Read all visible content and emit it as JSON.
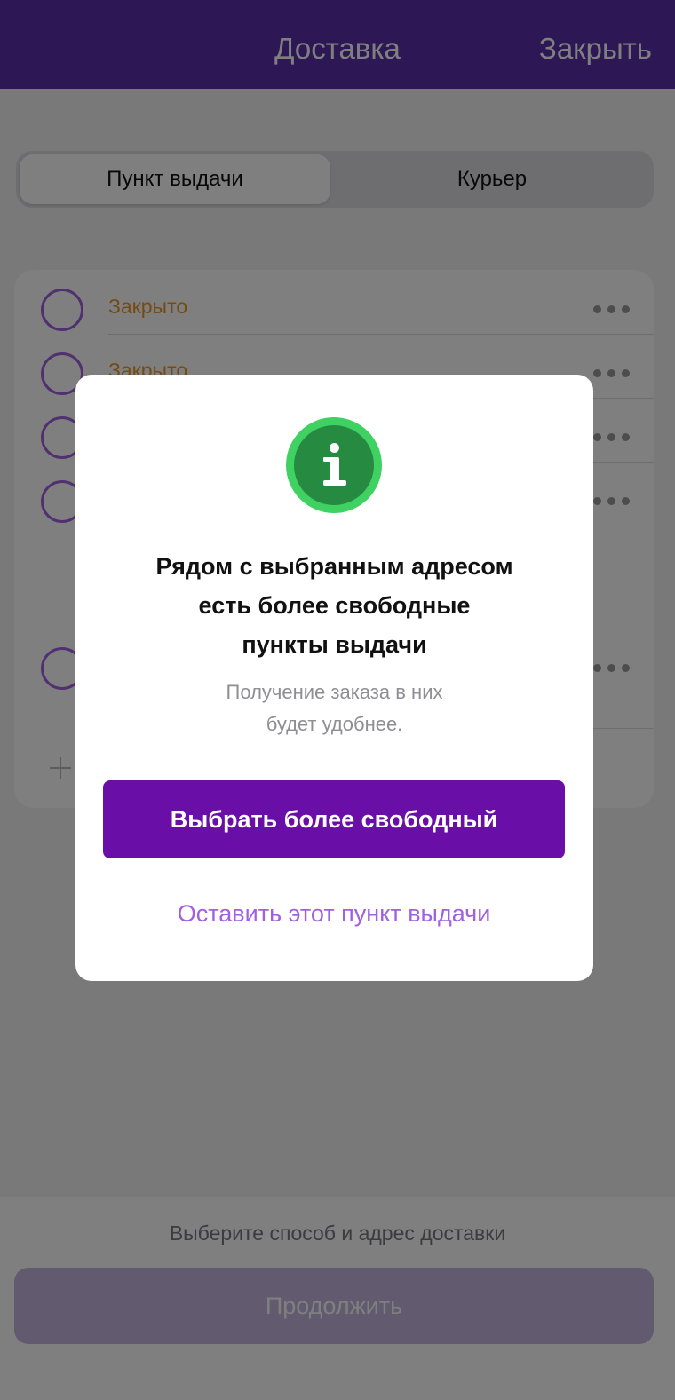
{
  "header": {
    "title": "Доставка",
    "close_label": "Закрыть"
  },
  "segmented": {
    "active_label": "Пункт выдачи",
    "inactive_label": "Курьер"
  },
  "list": {
    "rows": [
      {
        "status": "Закрыто"
      },
      {
        "status": "Закрыто"
      }
    ]
  },
  "footer": {
    "hint": "Выберите способ и адрес доставки",
    "continue_label": "Продолжить"
  },
  "dialog": {
    "icon": "info-icon",
    "title_lines": [
      "Рядом с выбранным адресом",
      "есть более свободные",
      "пункты выдачи"
    ],
    "subtitle_lines": [
      "Получение заказа в них",
      "будет удобнее."
    ],
    "primary_label": "Выбрать более свободный",
    "secondary_label": "Оставить этот пункт выдачи"
  },
  "colors": {
    "header": "#5b2fa8",
    "primary_button": "#6a0ea8",
    "accent": "#a160e0",
    "status_closed": "#e8962a",
    "info_badge": "#268a40"
  }
}
